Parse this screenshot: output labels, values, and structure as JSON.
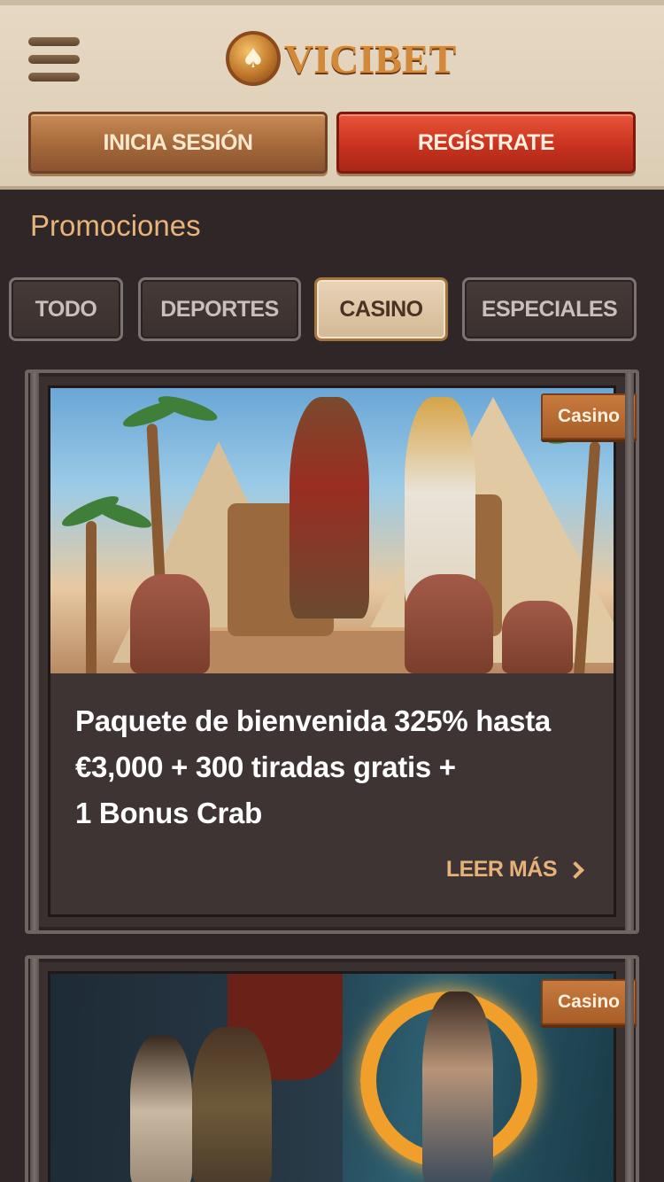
{
  "header": {
    "logo_text": "VICIBET",
    "login_label": "INICIA SESIÓN",
    "register_label": "REGÍSTRATE"
  },
  "page": {
    "title": "Promociones"
  },
  "tabs": [
    {
      "label": "TODO",
      "active": false
    },
    {
      "label": "DEPORTES",
      "active": false
    },
    {
      "label": "CASINO",
      "active": true
    },
    {
      "label": "ESPECIALES",
      "active": false
    }
  ],
  "promos": [
    {
      "badge": "Casino",
      "title_line1": "Paquete de bienvenida 325% hasta",
      "title_line2": "€3,000 + 300 tiradas gratis +",
      "title_line3": "1 Bonus Crab",
      "read_more": "LEER MÁS"
    },
    {
      "badge": "Casino"
    }
  ],
  "icons": {
    "menu": "hamburger-menu-icon",
    "logo": "spade-coin-icon",
    "read_more": "chevron-right-icon"
  },
  "colors": {
    "header_bg": "#e6d8c3",
    "page_bg": "#2f2727",
    "accent_gold": "#e8b47a",
    "register_red": "#c9321f",
    "login_brown": "#a4683a"
  }
}
